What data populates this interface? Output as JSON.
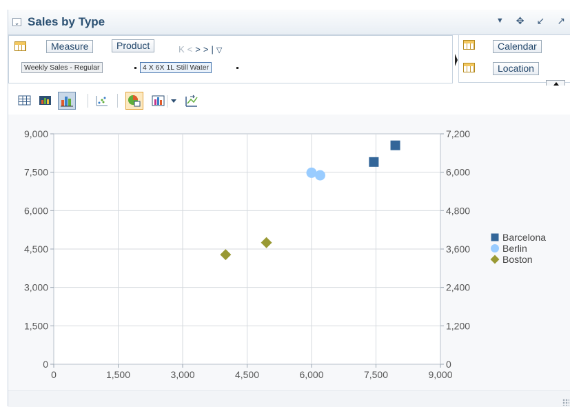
{
  "panel": {
    "title": "Sales by Type",
    "title_icons": [
      "dropdown-arrow-icon",
      "move-icon",
      "minimize-icon",
      "maximize-icon"
    ]
  },
  "edges": {
    "measure_label": "Measure",
    "product_label": "Product",
    "measure_value": "Weekly Sales - Regular",
    "product_value": "4 X 6X 1L Still Water",
    "calendar_label": "Calendar",
    "location_label": "Location"
  },
  "toolbar": {
    "buttons": [
      "table-view-icon",
      "chart-table-view-icon",
      "chart-view-icon",
      "scatter-type-icon",
      "chart-options-icon",
      "chart-type-icon",
      "chart-type-dropdown-icon",
      "swap-axes-icon"
    ]
  },
  "colors": {
    "barcelona": "#336699",
    "berlin": "#99ccff",
    "boston": "#999933",
    "title": "#2c5173"
  },
  "chart_data": {
    "type": "scatter",
    "title": "",
    "xlabel": "",
    "ylabel": "",
    "xlim": [
      0,
      9000
    ],
    "ylim": [
      0,
      9000
    ],
    "y2lim": [
      0,
      7200
    ],
    "x_ticks": [
      "0",
      "1,500",
      "3,000",
      "4,500",
      "6,000",
      "7,500",
      "9,000"
    ],
    "y_ticks": [
      "0",
      "1,500",
      "3,000",
      "4,500",
      "6,000",
      "7,500",
      "9,000"
    ],
    "y2_ticks": [
      "0",
      "1,200",
      "2,400",
      "3,600",
      "4,800",
      "6,000",
      "7,200"
    ],
    "grid": true,
    "legend_position": "right",
    "series": [
      {
        "name": "Barcelona",
        "marker": "square",
        "color": "#336699",
        "points": [
          [
            7450,
            7900
          ],
          [
            7950,
            8550
          ]
        ]
      },
      {
        "name": "Berlin",
        "marker": "circle",
        "color": "#99ccff",
        "points": [
          [
            6000,
            7480
          ],
          [
            6200,
            7380
          ]
        ]
      },
      {
        "name": "Boston",
        "marker": "diamond",
        "color": "#999933",
        "points": [
          [
            4000,
            4280
          ],
          [
            4950,
            4750
          ]
        ]
      }
    ]
  }
}
